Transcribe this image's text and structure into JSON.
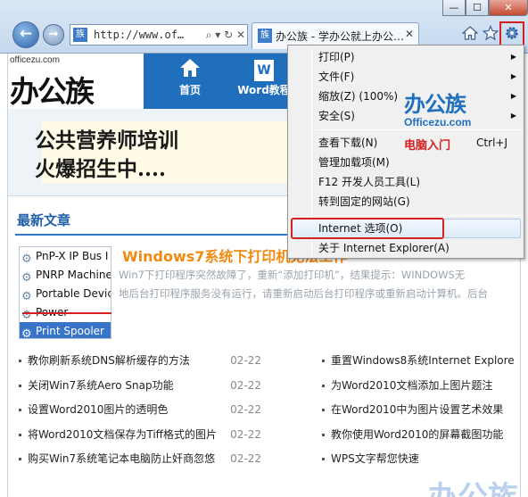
{
  "browser": {
    "address": "http://www.of…",
    "tab_title": "办公族 - 学办公就上办公…",
    "favicon_text": "族",
    "back_glyph": "←",
    "forward_glyph": "→",
    "addr_controls": "⌕ ▾ ↻ ✕",
    "tab_close_glyph": "✕",
    "window_controls": {
      "minimize": "—",
      "maximize": "☐",
      "close": "✕"
    },
    "toolbar_icons": [
      "home-icon",
      "star-icon",
      "gear-icon"
    ]
  },
  "site": {
    "logo_small": "officezu.com",
    "logo_big": "办公族",
    "nav": [
      {
        "label": "首页",
        "icon": "home-icon"
      },
      {
        "label": "Word教程",
        "icon": "word-doc-icon"
      }
    ],
    "word_icon_text": "W",
    "banner_lines": [
      "公共营养师培训",
      "火爆招生中...."
    ],
    "section_title": "最新文章",
    "services": [
      "PnP-X IP Bus I",
      "PNRP Machine",
      "Portable Devic",
      "Power",
      "Print Spooler"
    ],
    "selected_service_index": 4,
    "article_title": "Windows7系统下打印机无法工作",
    "article_desc": [
      "Win7下打印程序突然故障了，重新“添加打印机”，结果提示：WINDOWS无",
      "地后台打印程序服务没有运行，请重新启动后台打印程序或重新启动计算机。后台"
    ],
    "news_left": [
      {
        "title": "教你刷新系统DNS解析缓存的方法",
        "date": "02-22"
      },
      {
        "title": "关闭Win7系统Aero Snap功能",
        "date": "02-22"
      },
      {
        "title": "设置Word2010图片的透明色",
        "date": "02-22"
      },
      {
        "title": "将Word2010文档保存为Tiff格式的图片",
        "date": "02-22"
      },
      {
        "title": "购买Win7系统笔记本电脑防止奸商忽悠",
        "date": "02-22"
      }
    ],
    "news_right": [
      {
        "title": "重置Windows8系统Internet Explore"
      },
      {
        "title": "为Word2010文档添加上图片题注"
      },
      {
        "title": "在Word2010中为图片设置艺术效果"
      },
      {
        "title": "教你使用Word2010的屏幕截图功能"
      },
      {
        "title": "WPS文字帮您快速"
      }
    ],
    "watermark": "办公族"
  },
  "menu": {
    "items": [
      {
        "label": "打印(P)",
        "submenu": true
      },
      {
        "label": "文件(F)",
        "submenu": true
      },
      {
        "label": "缩放(Z) (100%)",
        "submenu": true
      },
      {
        "label": "安全(S)",
        "submenu": true
      },
      {
        "label": "查看下载(N)",
        "shortcut": "Ctrl+J"
      },
      {
        "label": "管理加载项(M)"
      },
      {
        "label": "F12 开发人员工具(L)"
      },
      {
        "label": "转到固定的网站(G)"
      },
      {
        "label": "Internet 选项(O)",
        "highlighted": true
      },
      {
        "label": "关于 Internet Explorer(A)"
      }
    ],
    "submenu_arrow": "▶",
    "overlay_logo": {
      "cn": "办公族",
      "en": "Officezu.com",
      "tag": "电脑入门"
    }
  },
  "colors": {
    "site_blue": "#1f6fbd",
    "annotation_red": "#d52020",
    "article_orange": "#f08a10",
    "selection_blue": "#3874c7"
  }
}
